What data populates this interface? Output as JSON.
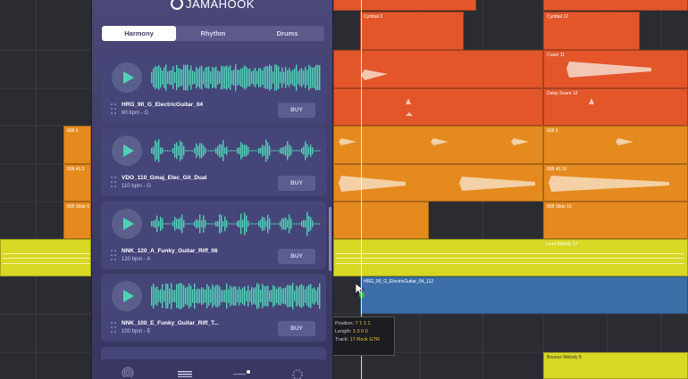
{
  "daw": {
    "regions": [
      {
        "id": "cymbal2",
        "label": "Cymbal 2",
        "color": "#e2562a"
      },
      {
        "id": "cymbal12",
        "label": "Cymbal 12",
        "color": "#e2562a"
      },
      {
        "id": "crash",
        "label": "Crash 11",
        "color": "#e2562a"
      },
      {
        "id": "delaysnare",
        "label": "Delay Snare 12",
        "color": "#e2562a"
      },
      {
        "id": "bw6a",
        "label": "808 6",
        "color": "#e58a1e"
      },
      {
        "id": "bw6b",
        "label": "808 6",
        "color": "#e58a1e"
      },
      {
        "id": "bw40a",
        "label": "808 40.3",
        "color": "#e58a1e"
      },
      {
        "id": "bw40b",
        "label": "808 40.10",
        "color": "#e58a1e"
      },
      {
        "id": "slide6",
        "label": "808 Slide 6",
        "color": "#e58a1e"
      },
      {
        "id": "slide16",
        "label": "808 Slide 16",
        "color": "#e58a1e"
      },
      {
        "id": "lead",
        "label": "Lead Melody 17",
        "color": "#d8d724"
      },
      {
        "id": "guitar",
        "label": "HRG_90_G_ElectricGuitar_04_112",
        "color": "#3c6ea8"
      },
      {
        "id": "bounce",
        "label": "Bounce Melody 8",
        "color": "#d8d724"
      }
    ],
    "tooltip": {
      "position_label": "Position:",
      "position_value": "7 1 1 1",
      "length_label": "Length:",
      "length_value": "1 0 0 0",
      "track_label": "Track:",
      "track_value": "17  Rock GTR"
    }
  },
  "panel": {
    "logo": "JAMAHOOK",
    "tabs": [
      "Harmony",
      "Rhythm",
      "Drums"
    ],
    "active_tab": "Harmony",
    "loops": [
      {
        "title": "HRG_90_G_ElectricGuitar_04",
        "meta": "90 bpm - G",
        "buy": "BUY"
      },
      {
        "title": "VDO_110_Gmaj_Elec_Git_Dual",
        "meta": "110 bpm - G",
        "buy": "BUY"
      },
      {
        "title": "NNK_120_A_Funky_Guitar_Riff_06",
        "meta": "120 bpm - A",
        "buy": "BUY"
      },
      {
        "title": "NNK_100_E_Funky_Guitar_Riff_T...",
        "meta": "100 bpm - E",
        "buy": "BUY"
      }
    ],
    "nav_icons": [
      "fingerprint-icon",
      "list-icon",
      "slider-icon",
      "settings-icon"
    ],
    "accent": "#4fd1b5"
  }
}
